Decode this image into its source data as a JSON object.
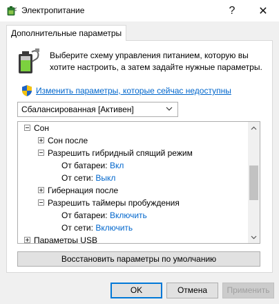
{
  "window": {
    "title": "Электропитание",
    "help_glyph": "?",
    "close_glyph": "✕"
  },
  "tab": {
    "label": "Дополнительные параметры"
  },
  "intro": {
    "text": "Выберите схему управления питанием, которую вы хотите настроить, а затем задайте нужные параметры.",
    "icon": "battery-plug-icon"
  },
  "change_link": {
    "text": "Изменить параметры, которые сейчас недоступны",
    "icon": "uac-shield-icon"
  },
  "plan_select": {
    "value": "Сбалансированная [Активен]"
  },
  "tree": {
    "rows": [
      {
        "label": "Сон",
        "expander": "minus"
      },
      {
        "label": "Сон после",
        "expander": "plus"
      },
      {
        "label": "Разрешить гибридный спящий режим",
        "expander": "minus"
      },
      {
        "label": "От батареи:",
        "value": "Вкл"
      },
      {
        "label": "От сети:",
        "value": "Выкл"
      },
      {
        "label": "Гибернация после",
        "expander": "plus"
      },
      {
        "label": "Разрешить таймеры пробуждения",
        "expander": "minus"
      },
      {
        "label": "От батареи:",
        "value": "Включить"
      },
      {
        "label": "От сети:",
        "value": "Включить"
      },
      {
        "label": "Параметры USB",
        "expander": "plus"
      }
    ]
  },
  "buttons": {
    "restore": "Восстановить параметры по умолчанию",
    "ok": "OK",
    "cancel": "Отмена",
    "apply": "Применить"
  },
  "colors": {
    "link": "#0066cc",
    "ok_border": "#0078d7"
  }
}
